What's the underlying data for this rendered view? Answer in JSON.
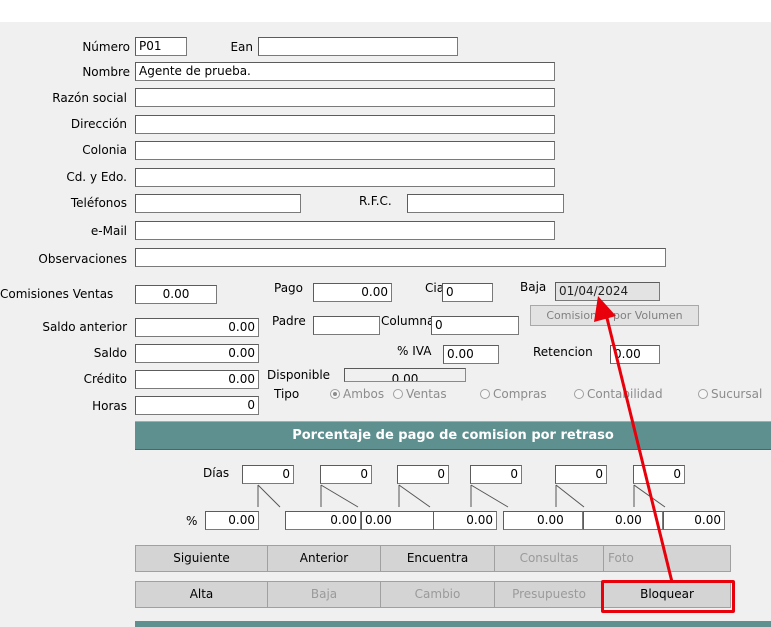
{
  "fields": {
    "numero_label": "Número",
    "numero_value": "P01",
    "ean_label": "Ean",
    "ean_value": "",
    "nombre_label": "Nombre",
    "nombre_value": "Agente de prueba.",
    "razon_social_label": "Razón social",
    "razon_social_value": "",
    "direccion_label": "Dirección",
    "direccion_value": "",
    "colonia_label": "Colonia",
    "colonia_value": "",
    "cd_edo_label": "Cd. y Edo.",
    "cd_edo_value": "",
    "telefonos_label": "Teléfonos",
    "telefonos_value": "",
    "rfc_label": "R.F.C.",
    "rfc_value": "",
    "email_label": "e-Mail",
    "email_value": "",
    "observaciones_label": "Observaciones",
    "observaciones_value": ""
  },
  "finance": {
    "comisiones_ventas_label": "Comisiones Ventas",
    "comisiones_ventas_value": "0.00",
    "pago_label": "Pago",
    "pago_value": "0.00",
    "cia_label": "Cia",
    "cia_value": "0",
    "baja_label": "Baja",
    "baja_value": "01/04/2024",
    "comisiones_volumen_button": "Comisiones por Volumen",
    "saldo_anterior_label": "Saldo anterior",
    "saldo_anterior_value": "0.00",
    "padre_label": "Padre",
    "padre_value": "",
    "columna_label": "Columna",
    "columna_value": "0",
    "saldo_label": "Saldo",
    "saldo_value": "0.00",
    "iva_label": "% IVA",
    "iva_value": "0.00",
    "retencion_label": "Retencion",
    "retencion_value": "0.00",
    "credito_label": "Crédito",
    "credito_value": "0.00",
    "disponible_label": "Disponible",
    "disponible_value": "0.00",
    "horas_label": "Horas",
    "horas_value": "0"
  },
  "tipo": {
    "label": "Tipo",
    "selected": "Ambos",
    "options": [
      "Ambos",
      "Ventas",
      "Compras",
      "Contabilidad",
      "Sucursal"
    ]
  },
  "retraso": {
    "title": "Porcentaje de pago de comision por retraso",
    "dias_label": "Días",
    "pct_label": "%",
    "dias": [
      "0",
      "0",
      "0",
      "0",
      "0",
      "0"
    ],
    "pct": [
      "0.00",
      "0.00",
      "0.00",
      "0.00",
      "0.00",
      "0.00",
      "0.00"
    ]
  },
  "buttons": {
    "row1": [
      "Siguiente",
      "Anterior",
      "Encuentra",
      "Consultas",
      "Foto"
    ],
    "row2": [
      "Alta",
      "Baja",
      "Cambio",
      "Presupuesto",
      "Bloquear"
    ]
  },
  "colors": {
    "header_bar": "#5f9090",
    "highlight": "#e8000b"
  }
}
